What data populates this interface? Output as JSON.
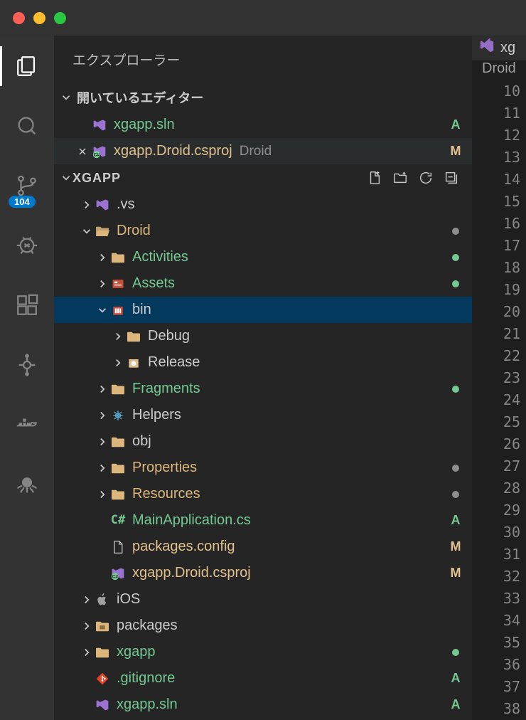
{
  "sidebar": {
    "title": "エクスプローラー",
    "openEditors": {
      "header": "開いているエディター",
      "items": [
        {
          "name": "xgapp.sln",
          "badge": "A",
          "close": false
        },
        {
          "name": "xgapp.Droid.csproj",
          "desc": "Droid",
          "badge": "M",
          "close": true
        }
      ]
    },
    "project": {
      "name": "XGAPP"
    },
    "tree": [
      {
        "lvl": 1,
        "kind": "folder-closed",
        "name": ".vs",
        "color": "white",
        "icon": "vs"
      },
      {
        "lvl": 1,
        "kind": "folder-open",
        "name": "Droid",
        "color": "folder",
        "badge_dot": "grey"
      },
      {
        "lvl": 2,
        "kind": "folder-closed",
        "name": "Activities",
        "color": "green",
        "badge_dot": "green"
      },
      {
        "lvl": 2,
        "kind": "folder-closed",
        "name": "Assets",
        "color": "green",
        "badge_dot": "green",
        "icon": "assets"
      },
      {
        "lvl": 2,
        "kind": "folder-open",
        "name": "bin",
        "color": "white",
        "selected": true,
        "icon": "bin"
      },
      {
        "lvl": 3,
        "kind": "folder-closed",
        "name": "Debug",
        "color": "white"
      },
      {
        "lvl": 3,
        "kind": "folder-closed",
        "name": "Release",
        "color": "white",
        "icon": "release"
      },
      {
        "lvl": 2,
        "kind": "folder-closed",
        "name": "Fragments",
        "color": "green",
        "badge_dot": "green"
      },
      {
        "lvl": 2,
        "kind": "folder-closed",
        "name": "Helpers",
        "color": "white",
        "icon": "helpers"
      },
      {
        "lvl": 2,
        "kind": "folder-closed",
        "name": "obj",
        "color": "white"
      },
      {
        "lvl": 2,
        "kind": "folder-closed",
        "name": "Properties",
        "color": "folder",
        "badge_dot": "grey"
      },
      {
        "lvl": 2,
        "kind": "folder-closed",
        "name": "Resources",
        "color": "folder",
        "badge_dot": "grey"
      },
      {
        "lvl": 2,
        "kind": "file",
        "name": "MainApplication.cs",
        "color": "green",
        "badge": "A",
        "icon": "cs"
      },
      {
        "lvl": 2,
        "kind": "file",
        "name": "packages.config",
        "color": "yellow",
        "badge": "M",
        "icon": "file"
      },
      {
        "lvl": 2,
        "kind": "file",
        "name": "xgapp.Droid.csproj",
        "color": "yellow",
        "badge": "M",
        "icon": "csproj"
      },
      {
        "lvl": 1,
        "kind": "folder-closed",
        "name": "iOS",
        "color": "white",
        "icon": "ios"
      },
      {
        "lvl": 1,
        "kind": "folder-closed",
        "name": "packages",
        "color": "white",
        "icon": "packages"
      },
      {
        "lvl": 1,
        "kind": "folder-closed",
        "name": "xgapp",
        "color": "green",
        "badge_dot": "green"
      },
      {
        "lvl": 1,
        "kind": "file",
        "name": ".gitignore",
        "color": "green",
        "badge": "A",
        "icon": "git"
      },
      {
        "lvl": 1,
        "kind": "file",
        "name": "xgapp.sln",
        "color": "green",
        "badge": "A",
        "icon": "vs"
      }
    ]
  },
  "activity": {
    "sc_badge": "104"
  },
  "editor": {
    "tab": "xg",
    "breadcrumb": "Droid",
    "lineStart": 10,
    "lineEnd": 38
  }
}
